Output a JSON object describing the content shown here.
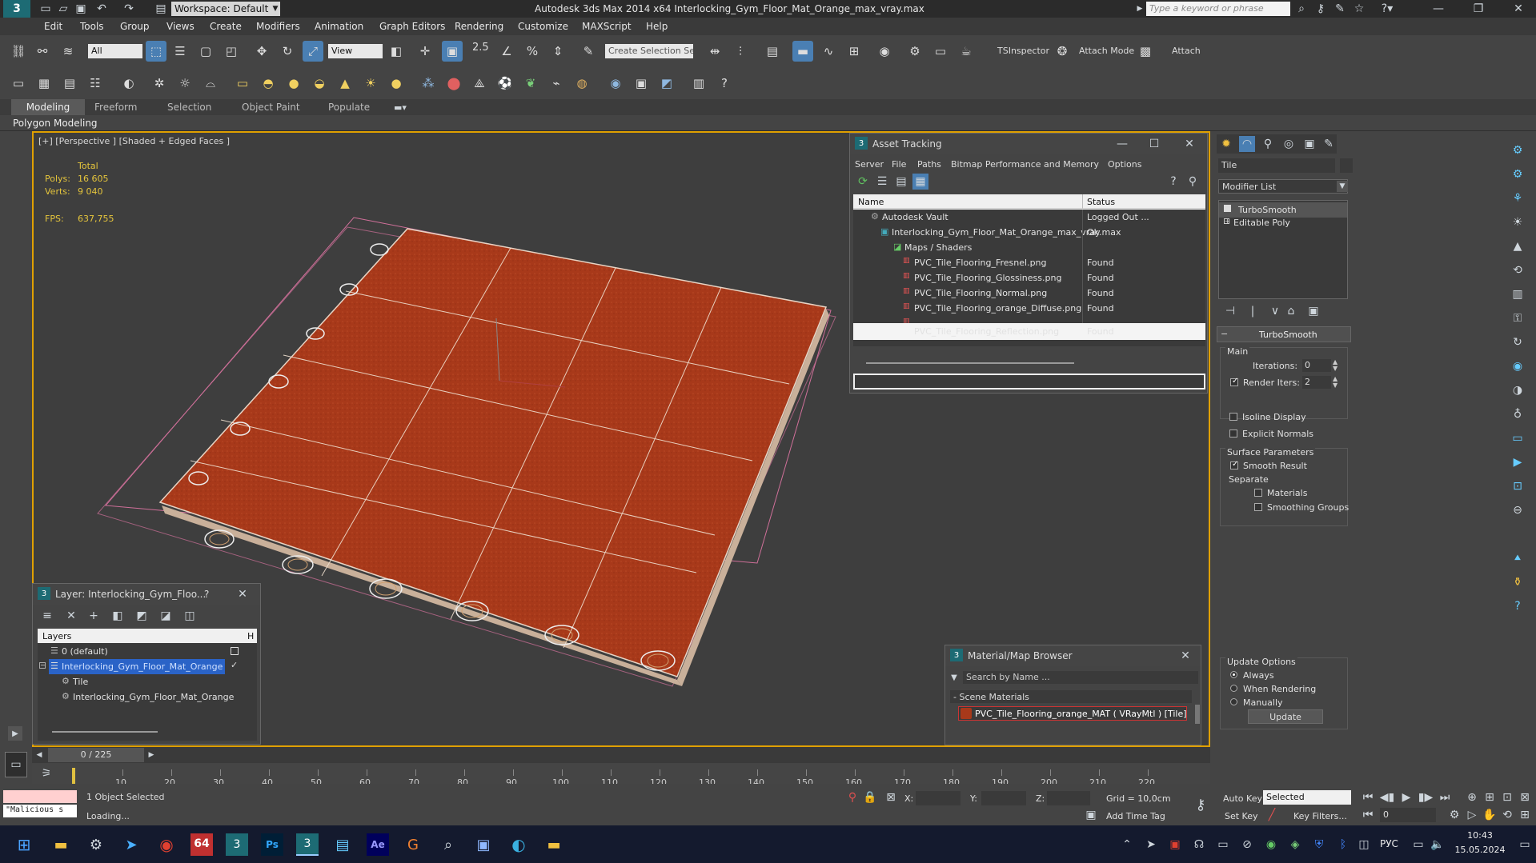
{
  "app": {
    "title": "Autodesk 3ds Max  2014 x64     Interlocking_Gym_Floor_Mat_Orange_max_vray.max",
    "workspace": "Workspace: Default",
    "search_placeholder": "Type a keyword or phrase"
  },
  "menu": [
    "Edit",
    "Tools",
    "Group",
    "Views",
    "Create",
    "Modifiers",
    "Animation",
    "Graph Editors",
    "Rendering",
    "Customize",
    "MAXScript",
    "Help"
  ],
  "toolbar": {
    "selection_filter": "All",
    "ref_coord": "View",
    "named_selection_placeholder": "Create Selection Se",
    "snap_value": "2.5",
    "tsinspector": "TSInspector",
    "attach_mode": "Attach Mode",
    "attach": "Attach"
  },
  "ribbon": {
    "tabs": [
      "Modeling",
      "Freeform",
      "Selection",
      "Object Paint",
      "Populate"
    ],
    "panel_label": "Polygon Modeling"
  },
  "viewport": {
    "label": "[+] [Perspective ] [Shaded + Edged Faces ]",
    "stats_header": "Total",
    "polys_label": "Polys:",
    "polys_value": "16 605",
    "verts_label": "Verts:",
    "verts_value": "9 040",
    "fps_label": "FPS:",
    "fps_value": "637,755",
    "mat_color": "#a8391a"
  },
  "asset_tracking": {
    "title": "Asset Tracking",
    "menu": [
      "Server",
      "File",
      "Paths",
      "Bitmap Performance and Memory",
      "Options"
    ],
    "col_name": "Name",
    "col_status": "Status",
    "rows": [
      {
        "name": "Autodesk Vault",
        "status": "Logged Out ..."
      },
      {
        "name": "Interlocking_Gym_Floor_Mat_Orange_max_vray.max",
        "status": "Ok"
      },
      {
        "name": "Maps / Shaders",
        "status": ""
      },
      {
        "name": "PVC_Tile_Flooring_Fresnel.png",
        "status": "Found"
      },
      {
        "name": "PVC_Tile_Flooring_Glossiness.png",
        "status": "Found"
      },
      {
        "name": "PVC_Tile_Flooring_Normal.png",
        "status": "Found"
      },
      {
        "name": "PVC_Tile_Flooring_orange_Diffuse.png",
        "status": "Found"
      },
      {
        "name": "PVC_Tile_Flooring_Reflection.png",
        "status": "Found"
      }
    ]
  },
  "layer_window": {
    "title": "Layer: Interlocking_Gym_Floo...",
    "help": "?",
    "header": "Layers",
    "header_right": "H",
    "rows": [
      {
        "name": "0 (default)"
      },
      {
        "name": "Interlocking_Gym_Floor_Mat_Orange"
      },
      {
        "name": "Tile"
      },
      {
        "name": "Interlocking_Gym_Floor_Mat_Orange"
      }
    ]
  },
  "material_browser": {
    "title": "Material/Map Browser",
    "search_placeholder": "Search by Name ...",
    "section": "- Scene Materials",
    "material": "PVC_Tile_Flooring_orange_MAT  ( VRayMtl )  [Tile]"
  },
  "command_panel": {
    "object_name": "Tile",
    "modifier_list": "Modifier List",
    "stack": [
      "TurboSmooth",
      "Editable Poly"
    ],
    "rollout_title": "TurboSmooth",
    "main_group": "Main",
    "iterations_label": "Iterations:",
    "iterations_value": "0",
    "render_iters_label": "Render Iters:",
    "render_iters_value": "2",
    "isoline": "Isoline Display",
    "explicit_normals": "Explicit Normals",
    "surface_params": "Surface Parameters",
    "smooth_result": "Smooth Result",
    "separate": "Separate",
    "materials": "Materials",
    "smoothing_groups": "Smoothing Groups",
    "update_options": "Update Options",
    "always": "Always",
    "when_rendering": "When Rendering",
    "manually": "Manually",
    "update_btn": "Update"
  },
  "timeline": {
    "frame": "0 / 225",
    "ticks": [
      "10",
      "20",
      "30",
      "40",
      "50",
      "60",
      "70",
      "80",
      "90",
      "100",
      "110",
      "120",
      "130",
      "140",
      "150",
      "160",
      "170",
      "180",
      "190",
      "200",
      "210",
      "220"
    ]
  },
  "status": {
    "maxscript": "\"Malicious s",
    "selected": "1 Object Selected",
    "loading": "Loading...",
    "x_label": "X:",
    "y_label": "Y:",
    "z_label": "Z:",
    "grid": "Grid = 10,0cm",
    "add_time_tag": "Add Time Tag",
    "auto_key": "Auto Key",
    "set_key": "Set Key",
    "selected_dropdown": "Selected",
    "key_filters": "Key Filters...",
    "frame_field": "0"
  },
  "taskbar": {
    "lang": "РУС",
    "time": "10:43",
    "date": "15.05.2024",
    "badge": "64"
  }
}
